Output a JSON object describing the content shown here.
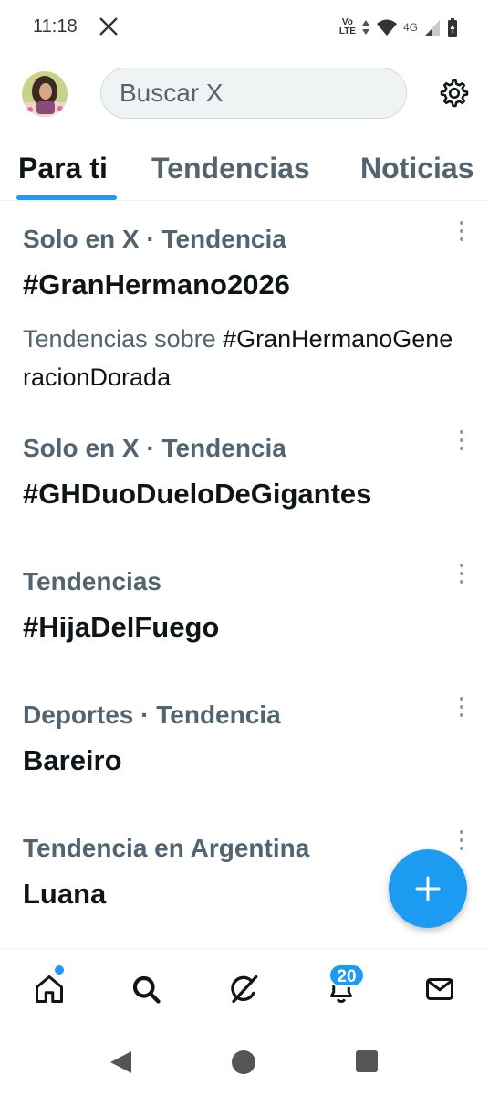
{
  "status_bar": {
    "time": "11:18",
    "volte_top": "Vo",
    "volte_bottom": "LTE",
    "network": "4G"
  },
  "header": {
    "search_placeholder": "Buscar X"
  },
  "tabs": [
    {
      "label": "Para ti",
      "active": true
    },
    {
      "label": "Tendencias",
      "active": false
    },
    {
      "label": "Noticias",
      "active": false
    }
  ],
  "trends": [
    {
      "meta": "Solo en X · Tendencia",
      "title": "#GranHermano2026",
      "desc_prefix": "Tendencias sobre ",
      "desc_tag": "#GranHermanoGeneracionDorada"
    },
    {
      "meta": "Solo en X · Tendencia",
      "title": "#GHDuoDueloDeGigantes"
    },
    {
      "meta": "Tendencias",
      "title": "#HijaDelFuego"
    },
    {
      "meta": "Deportes · Tendencia",
      "title": "Bareiro"
    },
    {
      "meta": "Tendencia en Argentina",
      "title": "Luana"
    }
  ],
  "bottom_nav": {
    "notifications_badge": "20",
    "icons": [
      "home-icon",
      "search-icon",
      "grok-icon",
      "bell-icon",
      "mail-icon"
    ]
  },
  "colors": {
    "accent": "#1d9bf0",
    "text": "#0f1419",
    "secondary_text": "#536471"
  }
}
